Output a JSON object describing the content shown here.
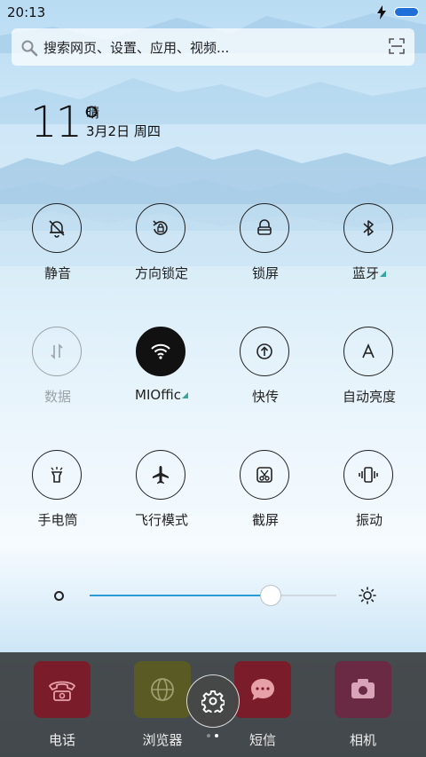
{
  "status": {
    "time": "20:13"
  },
  "search": {
    "placeholder": "搜索网页、设置、应用、视频..."
  },
  "weather": {
    "temperature": "11°",
    "condition": "晴",
    "date": "3月2日 周四"
  },
  "toggles": [
    {
      "label": "静音",
      "icon": "bell-off-icon",
      "state": "off"
    },
    {
      "label": "方向锁定",
      "icon": "rotation-lock-icon",
      "state": "off"
    },
    {
      "label": "锁屏",
      "icon": "lock-icon",
      "state": "off"
    },
    {
      "label": "蓝牙",
      "icon": "bluetooth-icon",
      "state": "off",
      "has_more": true
    },
    {
      "label": "数据",
      "icon": "mobile-data-icon",
      "state": "disabled"
    },
    {
      "label": "MIOffic",
      "icon": "wifi-icon",
      "state": "on",
      "has_more": true
    },
    {
      "label": "快传",
      "icon": "share-transfer-icon",
      "state": "off"
    },
    {
      "label": "自动亮度",
      "icon": "auto-brightness-icon",
      "state": "off"
    },
    {
      "label": "手电筒",
      "icon": "flashlight-icon",
      "state": "off"
    },
    {
      "label": "飞行模式",
      "icon": "airplane-icon",
      "state": "off"
    },
    {
      "label": "截屏",
      "icon": "screenshot-icon",
      "state": "off"
    },
    {
      "label": "振动",
      "icon": "vibrate-icon",
      "state": "off"
    }
  ],
  "brightness": {
    "level": 0.73
  },
  "dock": {
    "apps": [
      {
        "label": "电话",
        "icon": "phone-icon",
        "color": "#7a1c2a"
      },
      {
        "label": "浏览器",
        "icon": "globe-icon",
        "color": "#5a5a24"
      },
      {
        "label": "短信",
        "icon": "message-icon",
        "color": "#7a1c2a"
      },
      {
        "label": "相机",
        "icon": "camera-icon",
        "color": "#6b2a44"
      }
    ],
    "page_count": 2,
    "active_page": 1
  },
  "colors": {
    "accent": "#2a9bd4",
    "battery": "#1e6fd8",
    "tile_on": "#111111"
  }
}
